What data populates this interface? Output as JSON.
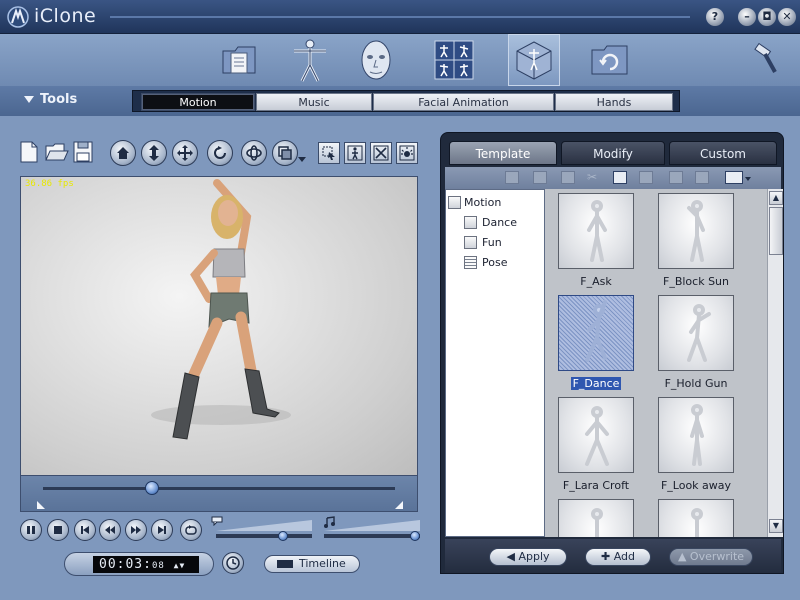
{
  "app": {
    "title": "iClone"
  },
  "window_controls": {
    "help": "?",
    "minimize": "–",
    "restore": "◘",
    "close": "✕"
  },
  "modules": [
    {
      "name": "project-module",
      "icon": "folder-document-icon"
    },
    {
      "name": "actor-module",
      "icon": "figure-icon"
    },
    {
      "name": "face-module",
      "icon": "face-icon"
    },
    {
      "name": "animation-module",
      "icon": "poses-icon"
    },
    {
      "name": "stage-module",
      "icon": "stage-cube-icon"
    },
    {
      "name": "export-module",
      "icon": "export-folder-icon"
    },
    {
      "name": "tools-module",
      "icon": "hammer-icon"
    }
  ],
  "tools_label": "Tools",
  "tabs": [
    "Motion",
    "Music",
    "Facial Animation",
    "Hands"
  ],
  "viewport": {
    "fps": "36.86 fps"
  },
  "time": {
    "main": "00:03:",
    "frames": "08"
  },
  "timeline_label": "Timeline",
  "right_tabs": [
    "Template",
    "Modify",
    "Custom"
  ],
  "tree": {
    "root": "Motion",
    "children": [
      "Dance",
      "Fun",
      "Pose"
    ]
  },
  "gallery": [
    {
      "label": "F_Ask",
      "selected": false
    },
    {
      "label": "F_Block Sun",
      "selected": false
    },
    {
      "label": "F_Dance",
      "selected": true
    },
    {
      "label": "F_Hold Gun",
      "selected": false
    },
    {
      "label": "F_Lara Croft",
      "selected": false
    },
    {
      "label": "F_Look away",
      "selected": false
    }
  ],
  "actions": {
    "apply": "Apply",
    "add": "Add",
    "overwrite": "Overwrite"
  },
  "playback": {
    "position": 0.31,
    "volume": 0.7,
    "speed": 0.95
  }
}
